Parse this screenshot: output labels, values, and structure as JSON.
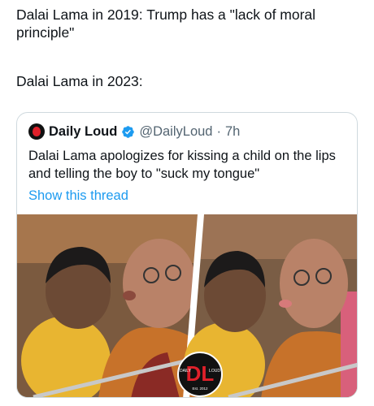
{
  "caption": {
    "line1": "Dalai Lama in 2019: Trump has a \"lack of moral principle\"",
    "line2": "Dalai Lama in 2023:"
  },
  "quote": {
    "name": "Daily Loud",
    "handle": "@DailyLoud",
    "separator": "·",
    "time": "7h",
    "text": "Dalai Lama apologizes for kissing a child on the lips and telling the boy to \"suck my tongue\"",
    "show_thread": "Show this thread",
    "verified_color": "#1d9bf0"
  },
  "media": {
    "watermark_left": "DAILY",
    "watermark_right": "LOUD",
    "watermark_est": "Est. 2012",
    "watermark_color": "#e0202a"
  }
}
